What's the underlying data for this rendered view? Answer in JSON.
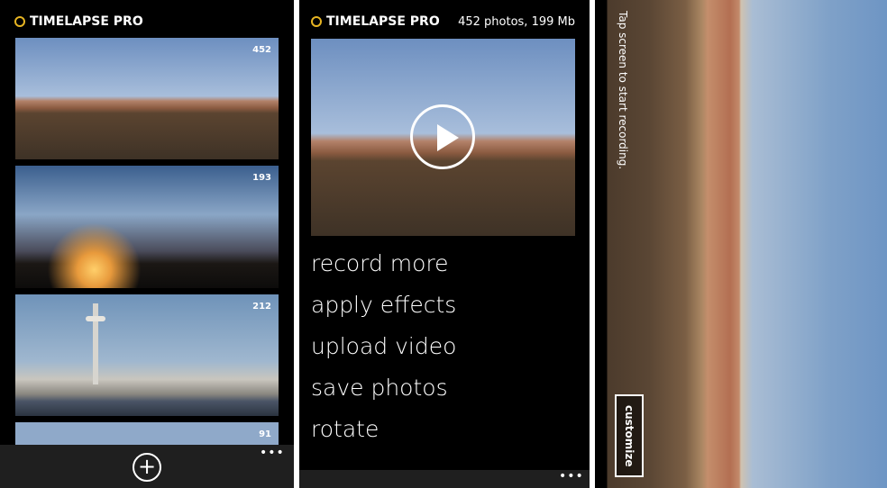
{
  "app": {
    "title": "TIMELAPSE PRO"
  },
  "gallery": {
    "items": [
      {
        "count": "452"
      },
      {
        "count": "193"
      },
      {
        "count": "212"
      },
      {
        "count": "91"
      }
    ],
    "more": "•••"
  },
  "detail": {
    "summary": "452 photos, 199 Mb",
    "menu": [
      "record more",
      "apply effects",
      "upload video",
      "save photos",
      "rotate"
    ],
    "more": "•••"
  },
  "camera": {
    "hint": "Tap screen to start recording.",
    "customize": "customize"
  }
}
